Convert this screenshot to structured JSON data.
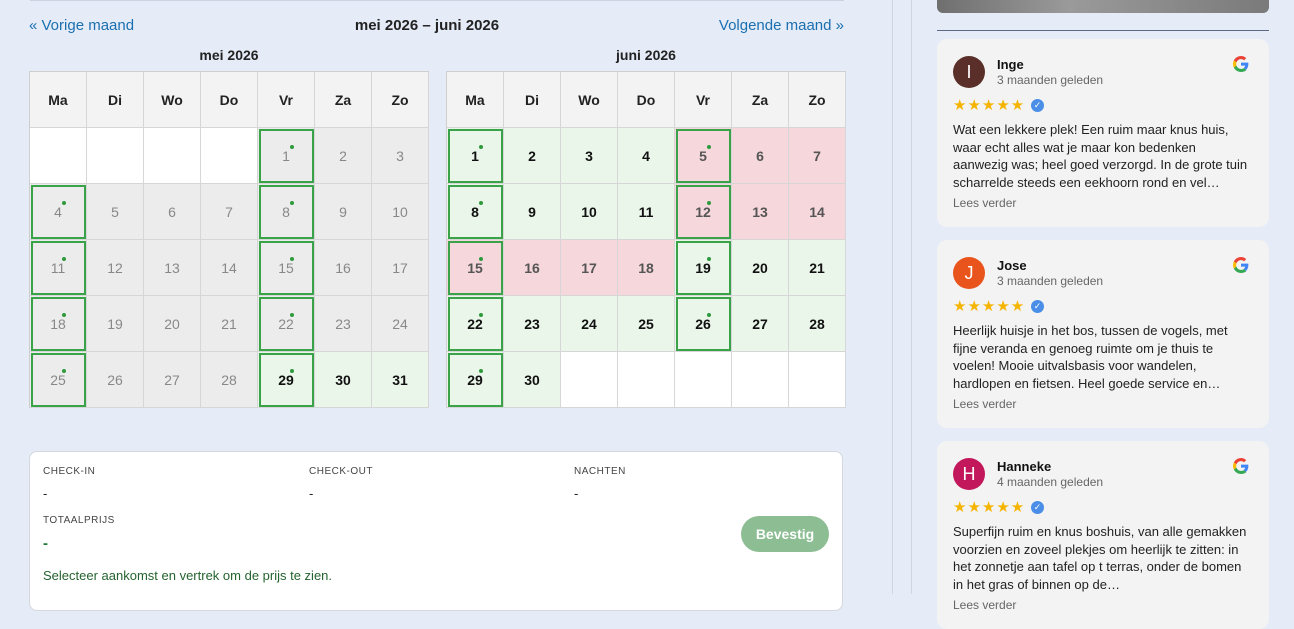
{
  "nav": {
    "prev": "« Vorige maand",
    "next": "Volgende maand »",
    "range": "mei 2026 – juni 2026"
  },
  "weekdays": [
    "Ma",
    "Di",
    "Wo",
    "Do",
    "Vr",
    "Za",
    "Zo"
  ],
  "months": [
    {
      "title": "mei 2026",
      "days": [
        {
          "d": "",
          "s": "empty"
        },
        {
          "d": "",
          "s": "empty"
        },
        {
          "d": "",
          "s": "empty"
        },
        {
          "d": "",
          "s": "empty"
        },
        {
          "d": "1",
          "s": "past",
          "a": true
        },
        {
          "d": "2",
          "s": "past"
        },
        {
          "d": "3",
          "s": "past"
        },
        {
          "d": "4",
          "s": "past",
          "a": true
        },
        {
          "d": "5",
          "s": "past"
        },
        {
          "d": "6",
          "s": "past"
        },
        {
          "d": "7",
          "s": "past"
        },
        {
          "d": "8",
          "s": "past",
          "a": true
        },
        {
          "d": "9",
          "s": "past"
        },
        {
          "d": "10",
          "s": "past"
        },
        {
          "d": "11",
          "s": "past",
          "a": true
        },
        {
          "d": "12",
          "s": "past"
        },
        {
          "d": "13",
          "s": "past"
        },
        {
          "d": "14",
          "s": "past"
        },
        {
          "d": "15",
          "s": "past",
          "a": true
        },
        {
          "d": "16",
          "s": "past"
        },
        {
          "d": "17",
          "s": "past"
        },
        {
          "d": "18",
          "s": "past",
          "a": true
        },
        {
          "d": "19",
          "s": "past"
        },
        {
          "d": "20",
          "s": "past"
        },
        {
          "d": "21",
          "s": "past"
        },
        {
          "d": "22",
          "s": "past",
          "a": true
        },
        {
          "d": "23",
          "s": "past"
        },
        {
          "d": "24",
          "s": "past"
        },
        {
          "d": "25",
          "s": "past",
          "a": true
        },
        {
          "d": "26",
          "s": "past"
        },
        {
          "d": "27",
          "s": "past"
        },
        {
          "d": "28",
          "s": "past"
        },
        {
          "d": "29",
          "s": "avail",
          "a": true
        },
        {
          "d": "30",
          "s": "avail"
        },
        {
          "d": "31",
          "s": "avail"
        }
      ]
    },
    {
      "title": "juni 2026",
      "days": [
        {
          "d": "1",
          "s": "avail",
          "a": true
        },
        {
          "d": "2",
          "s": "avail"
        },
        {
          "d": "3",
          "s": "avail"
        },
        {
          "d": "4",
          "s": "avail"
        },
        {
          "d": "5",
          "s": "booked",
          "a": true
        },
        {
          "d": "6",
          "s": "booked"
        },
        {
          "d": "7",
          "s": "booked"
        },
        {
          "d": "8",
          "s": "avail",
          "a": true
        },
        {
          "d": "9",
          "s": "avail"
        },
        {
          "d": "10",
          "s": "avail"
        },
        {
          "d": "11",
          "s": "avail"
        },
        {
          "d": "12",
          "s": "booked",
          "a": true
        },
        {
          "d": "13",
          "s": "booked"
        },
        {
          "d": "14",
          "s": "booked"
        },
        {
          "d": "15",
          "s": "booked",
          "a": true
        },
        {
          "d": "16",
          "s": "booked"
        },
        {
          "d": "17",
          "s": "booked"
        },
        {
          "d": "18",
          "s": "booked"
        },
        {
          "d": "19",
          "s": "avail",
          "a": true
        },
        {
          "d": "20",
          "s": "avail"
        },
        {
          "d": "21",
          "s": "avail"
        },
        {
          "d": "22",
          "s": "avail",
          "a": true
        },
        {
          "d": "23",
          "s": "avail"
        },
        {
          "d": "24",
          "s": "avail"
        },
        {
          "d": "25",
          "s": "avail"
        },
        {
          "d": "26",
          "s": "avail",
          "a": true
        },
        {
          "d": "27",
          "s": "avail"
        },
        {
          "d": "28",
          "s": "avail"
        },
        {
          "d": "29",
          "s": "avail",
          "a": true
        },
        {
          "d": "30",
          "s": "avail"
        },
        {
          "d": "",
          "s": "empty"
        },
        {
          "d": "",
          "s": "empty"
        },
        {
          "d": "",
          "s": "empty"
        },
        {
          "d": "",
          "s": "empty"
        },
        {
          "d": "",
          "s": "empty"
        }
      ]
    }
  ],
  "summary": {
    "checkin_label": "CHECK-IN",
    "checkin_value": "-",
    "checkout_label": "CHECK-OUT",
    "checkout_value": "-",
    "nights_label": "NACHTEN",
    "nights_value": "-",
    "total_label": "TOTAALPRIJS",
    "total_value": "-",
    "hint": "Selecteer aankomst en vertrek om de prijs te zien.",
    "confirm_label": "Bevestig"
  },
  "reviews": [
    {
      "initial": "I",
      "color": "#5a2f2a",
      "name": "Inge",
      "time": "3 maanden geleden",
      "stars": "★★★★★",
      "text": "Wat een lekkere plek! Een ruim maar knus huis, waar echt alles wat je maar kon bedenken aanwezig was; heel goed verzorgd. In de grote tuin scharrelde steeds een eekhoorn rond en vel…",
      "more": "Lees verder"
    },
    {
      "initial": "J",
      "color": "#e8541c",
      "name": "Jose",
      "time": "3 maanden geleden",
      "stars": "★★★★★",
      "text": "Heerlijk huisje in het bos, tussen de vogels, met fijne veranda en genoeg ruimte om je thuis te voelen! Mooie uitvalsbasis voor wandelen, hardlopen en fietsen. Heel goede service en…",
      "more": "Lees verder"
    },
    {
      "initial": "H",
      "color": "#c2185b",
      "name": "Hanneke",
      "time": "4 maanden geleden",
      "stars": "★★★★★",
      "text": "Superfijn ruim en knus boshuis, van alle gemakken voorzien en zoveel plekjes om heerlijk te zitten: in het zonnetje aan tafel op t terras, onder de bomen in het gras of binnen op de…",
      "more": "Lees verder"
    }
  ]
}
